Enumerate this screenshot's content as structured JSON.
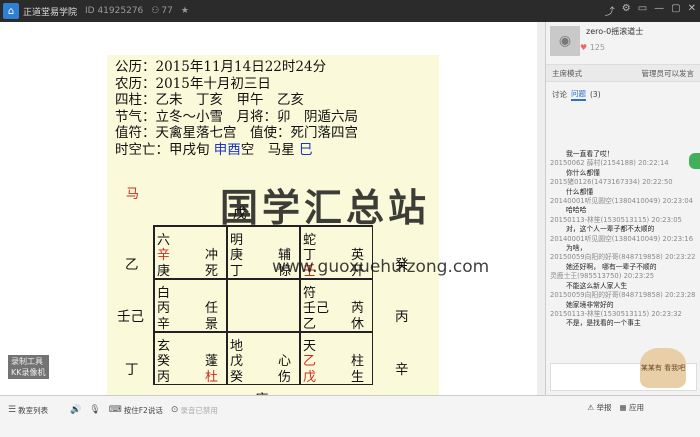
{
  "titlebar": {
    "title": "正道堂易学院",
    "room_id": "ID 41925276",
    "viewers": "77",
    "star": "★",
    "controls": [
      "⤴",
      "⚙",
      "▭",
      "—",
      "▢",
      "✕"
    ]
  },
  "slide": {
    "lines": [
      "公历：2015年11月14日22时24分",
      "农历：2015年十月初三日",
      "四柱：乙未　丁亥　甲午　乙亥",
      "节气：立冬～小雪　月将：卯　阴遁六局",
      "值符：天禽星落七宫　值使：死门落四宫"
    ],
    "last_line_prefix": "时空亡：甲戌旬 ",
    "last_line_blue1": "申酉",
    "last_line_mid": "空　马星 ",
    "last_line_blue2": "巳",
    "ma_label": "马",
    "top_label": "戊",
    "bottom_label": "庚",
    "left_labels": [
      "乙",
      "壬己",
      "丁"
    ],
    "right_labels": [
      "癸",
      "丙",
      "辛"
    ],
    "cells": [
      {
        "a": "六",
        "b": "辛",
        "c": "庚",
        "d": "冲",
        "e": "死"
      },
      {
        "a": "明",
        "b": "庚",
        "c": "丁",
        "d": "辅",
        "e": "惊"
      },
      {
        "a": "蛇",
        "b": "丁",
        "c": "壬",
        "d": "英",
        "e": "开"
      },
      {
        "a": "白",
        "b": "丙",
        "c": "辛",
        "d": "任",
        "e": "景"
      },
      {
        "a": "",
        "b": "",
        "c": "",
        "d": "",
        "e": ""
      },
      {
        "a": "符",
        "b": "壬己",
        "c": "乙",
        "d": "芮",
        "e": "休"
      },
      {
        "a": "玄",
        "b": "癸",
        "c": "丙",
        "d": "蓬",
        "e": "杜"
      },
      {
        "a": "地",
        "b": "戊",
        "c": "癸",
        "d": "心",
        "e": "伤"
      },
      {
        "a": "天",
        "b": "乙",
        "c": "戊",
        "d": "柱",
        "e": "生"
      }
    ]
  },
  "watermark": {
    "text": "国学汇总站",
    "url": "www.guoxuehuizong.com"
  },
  "logo": {
    "line1": "录制工具",
    "line2": "KK录像机"
  },
  "sidebar": {
    "teacher_name": "zero-0摇滚道士",
    "likes": "125",
    "mode_label": "主席模式",
    "mode_right": "管理员可以发言",
    "tab_discuss": "讨论",
    "tab_question": "问题",
    "question_count": "(3)",
    "chat": [
      {
        "meta": "",
        "msg": "我一直看了哎！"
      },
      {
        "meta": "20150062 薛村(2154188) 20:22:14",
        "msg": ""
      },
      {
        "meta": "",
        "msg": "你什么都懂"
      },
      {
        "meta": "2015猪0126(1473167334) 20:22:50",
        "msg": ""
      },
      {
        "meta": "",
        "msg": "什么都懂"
      },
      {
        "meta": "20140001听见圆空(1380410049) 20:23:04",
        "msg": ""
      },
      {
        "meta": "",
        "msg": "哈哈哈"
      },
      {
        "meta": "20150113-林笙(1530513115) 20:23:05",
        "msg": ""
      },
      {
        "meta": "",
        "msg": "对，这个人一辈子都不太顺的"
      },
      {
        "meta": "20140001听见圆空(1380410049) 20:23:16",
        "msg": ""
      },
      {
        "meta": "",
        "msg": "为啥，"
      },
      {
        "meta": "20150059向阳的好哥(848719858) 20:23:22",
        "msg": ""
      },
      {
        "meta": "",
        "msg": "她还好啊，  哪有一辈子不顺的"
      },
      {
        "meta": "灵鹿士王(985513750) 20:23:25",
        "msg": ""
      },
      {
        "meta": "",
        "msg": "不能这么新人家人生"
      },
      {
        "meta": "20150059向阳的好哥(848719858) 20:23:28",
        "msg": ""
      },
      {
        "meta": "",
        "msg": "她家境非常好的"
      },
      {
        "meta": "20150113-林笙(1530513115) 20:23:32",
        "msg": ""
      },
      {
        "meta": "",
        "msg": "不是，是找看的一个事主"
      }
    ],
    "cat_label": "某某有 看我吧"
  },
  "bottom": {
    "course_list": "教室列表",
    "press_talk": "按住F2说话",
    "mic_disabled": "录音已禁用",
    "report": "举报",
    "apps": "应用"
  }
}
